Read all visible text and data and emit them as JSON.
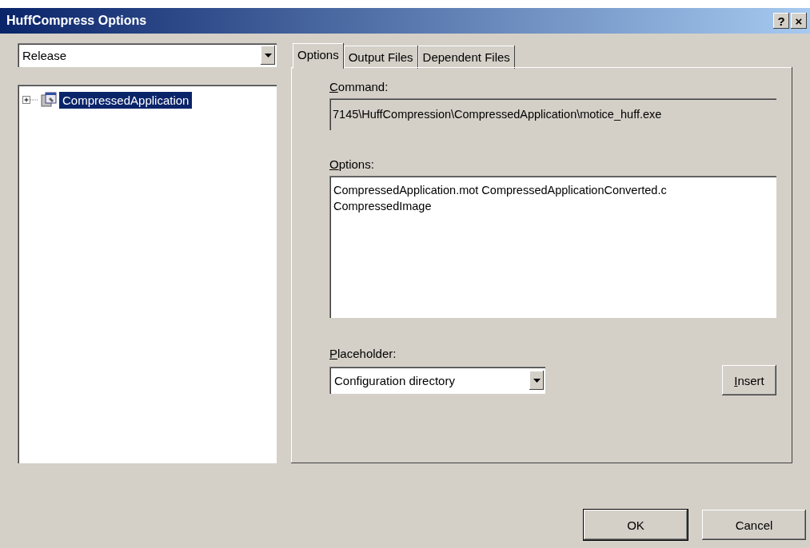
{
  "window": {
    "title": "HuffCompress Options",
    "help_button": "?",
    "close_button": "×"
  },
  "configuration": {
    "value": "Release"
  },
  "tree": [
    {
      "label": "CompressedApplication",
      "selected": true,
      "expanded": false
    }
  ],
  "tabs": [
    {
      "label": "Options",
      "selected": true
    },
    {
      "label": "Output Files",
      "selected": false
    },
    {
      "label": "Dependent Files",
      "selected": false
    }
  ],
  "command": {
    "label": "Command:",
    "value": "7145\\HuffCompression\\CompressedApplication\\motice_huff.exe"
  },
  "options": {
    "label": "Options:",
    "lines": [
      "CompressedApplication.mot CompressedApplicationConverted.c",
      "CompressedImage"
    ]
  },
  "placeholder": {
    "label": "Placeholder:",
    "value": "Configuration directory"
  },
  "insert_button": "Insert",
  "buttons": [
    "OK",
    "Cancel"
  ]
}
